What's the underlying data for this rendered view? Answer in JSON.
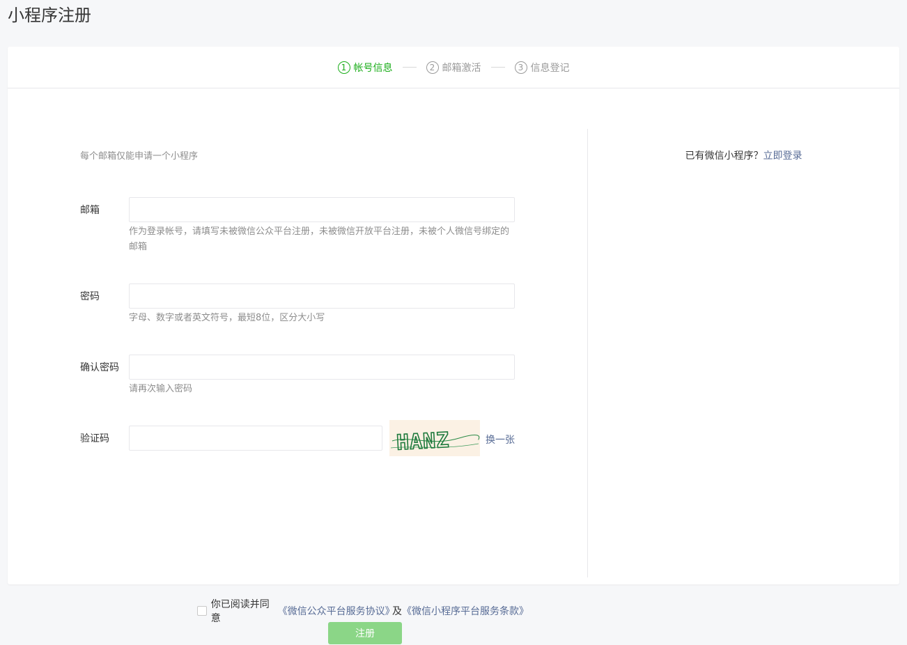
{
  "page": {
    "title": "小程序注册"
  },
  "steps": [
    {
      "num": "1",
      "label": "帐号信息",
      "active": true
    },
    {
      "num": "2",
      "label": "邮箱激活",
      "active": false
    },
    {
      "num": "3",
      "label": "信息登记",
      "active": false
    }
  ],
  "form": {
    "tip": "每个邮箱仅能申请一个小程序",
    "email": {
      "label": "邮箱",
      "value": "",
      "hint": "作为登录帐号，请填写未被微信公众平台注册，未被微信开放平台注册，未被个人微信号绑定的邮箱"
    },
    "password": {
      "label": "密码",
      "value": "",
      "hint": "字母、数字或者英文符号，最短8位，区分大小写"
    },
    "confirm": {
      "label": "确认密码",
      "value": "",
      "hint": "请再次输入密码"
    },
    "captcha": {
      "label": "验证码",
      "value": "",
      "image_text": "HANZ",
      "refresh_label": "换一张"
    },
    "agreement": {
      "prefix": "你已阅读并同意",
      "link1": "《微信公众平台服务协议》",
      "middle": "及",
      "link2": "《微信小程序平台服务条款》"
    },
    "submit_label": "注册"
  },
  "sidebar": {
    "prompt": "已有微信小程序？",
    "login_link": "立即登录"
  },
  "colors": {
    "accent": "#1aad19",
    "link": "#576b95",
    "submit_disabled": "#8bd687",
    "captcha_bg": "#fbf1e4",
    "captcha_text": "#1e7a3c"
  }
}
